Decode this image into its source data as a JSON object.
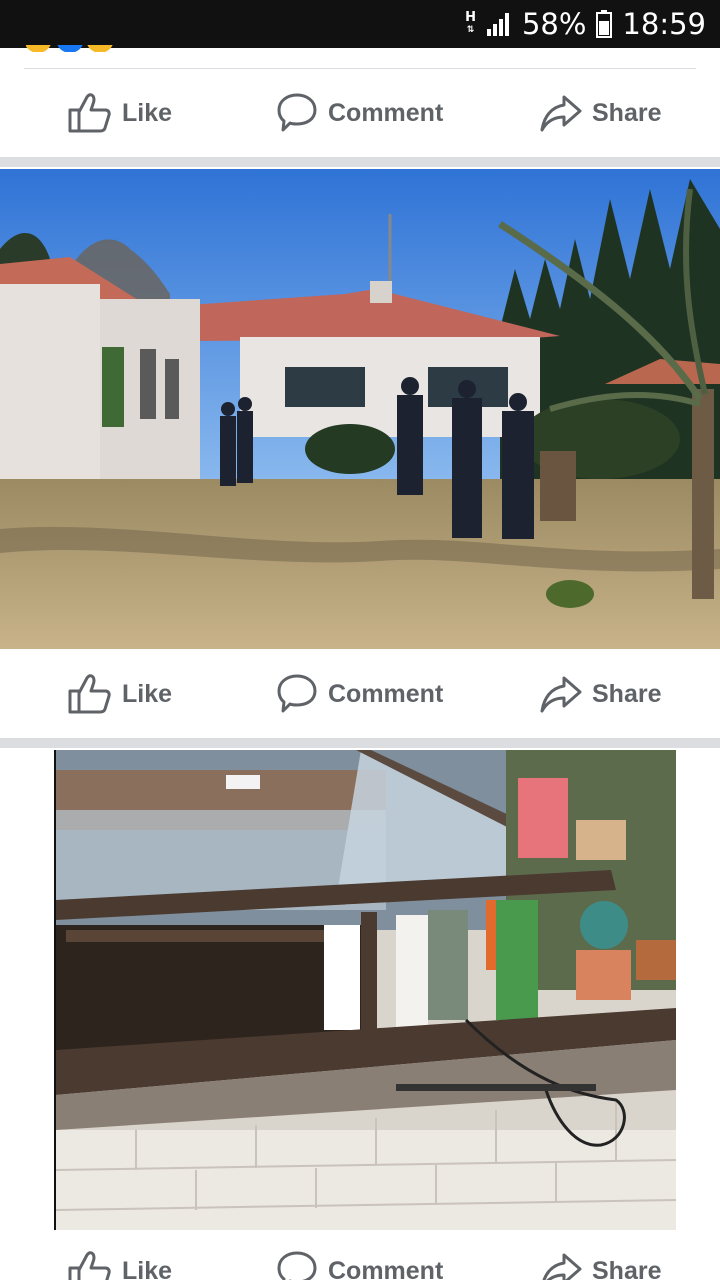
{
  "status_bar": {
    "network_indicator": "H",
    "battery_percent": "58%",
    "time": "18:59"
  },
  "post_actions": {
    "like_label": "Like",
    "comment_label": "Comment",
    "share_label": "Share"
  },
  "icons": {
    "like": "thumbs-up-icon",
    "comment": "speech-bubble-icon",
    "share": "share-arrow-icon",
    "signal": "signal-bars-icon",
    "battery": "battery-icon"
  },
  "colors": {
    "status_bar_bg": "#111111",
    "action_text": "#5f6368",
    "divider_band": "#dcdde1"
  }
}
